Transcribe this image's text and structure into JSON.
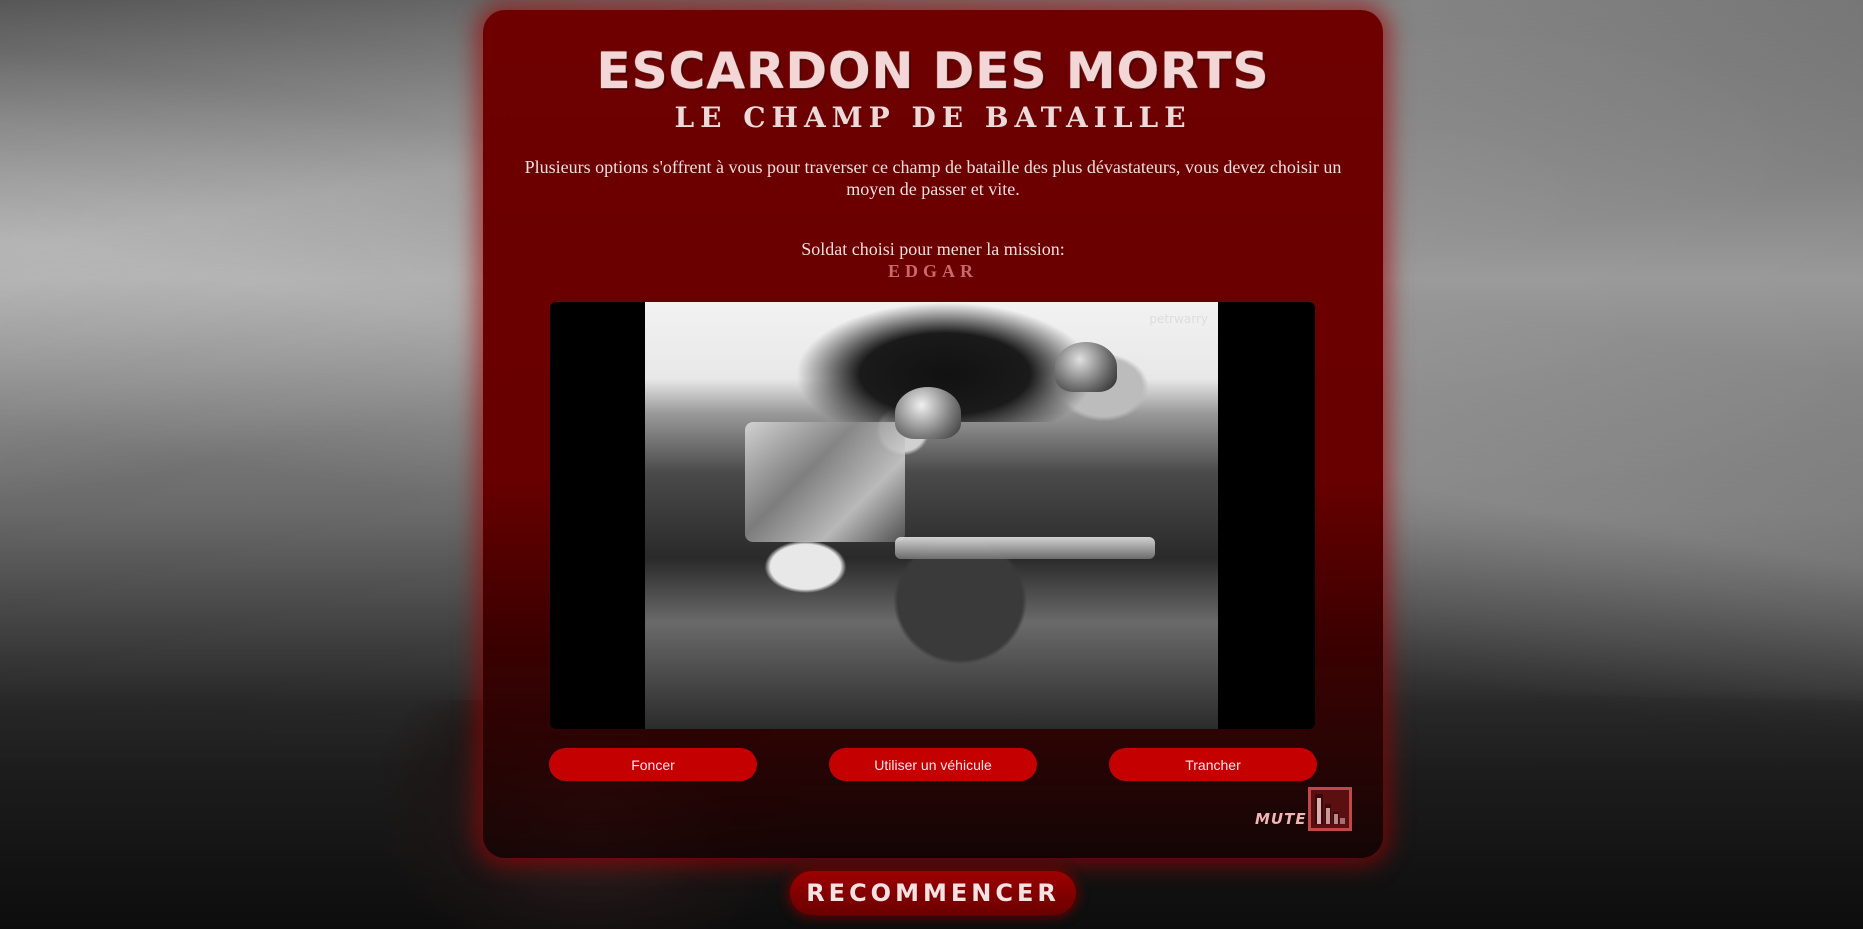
{
  "game": {
    "title": "ESCARDON DES MORTS",
    "subtitle": "LE CHAMP DE BATAILLE",
    "intro": "Plusieurs options s'offrent à vous pour traverser ce champ de bataille des plus dévastateurs, vous devez choisir un moyen de passer et vite.",
    "soldier_label": "Soldat choisi pour mener la mission:",
    "soldier_name": "EDGAR"
  },
  "video": {
    "watermark": "petrwarry"
  },
  "choices": [
    {
      "label": "Foncer"
    },
    {
      "label": "Utiliser un véhicule"
    },
    {
      "label": "Trancher"
    }
  ],
  "audio": {
    "mute_label": "MUTE",
    "icon": "volume-bars-icon"
  },
  "restart": {
    "label": "RECOMMENCER"
  },
  "colors": {
    "panel": "#6e0000",
    "button": "#c40000",
    "soldier_name": "#c86a6a",
    "text": "#f2dede"
  }
}
